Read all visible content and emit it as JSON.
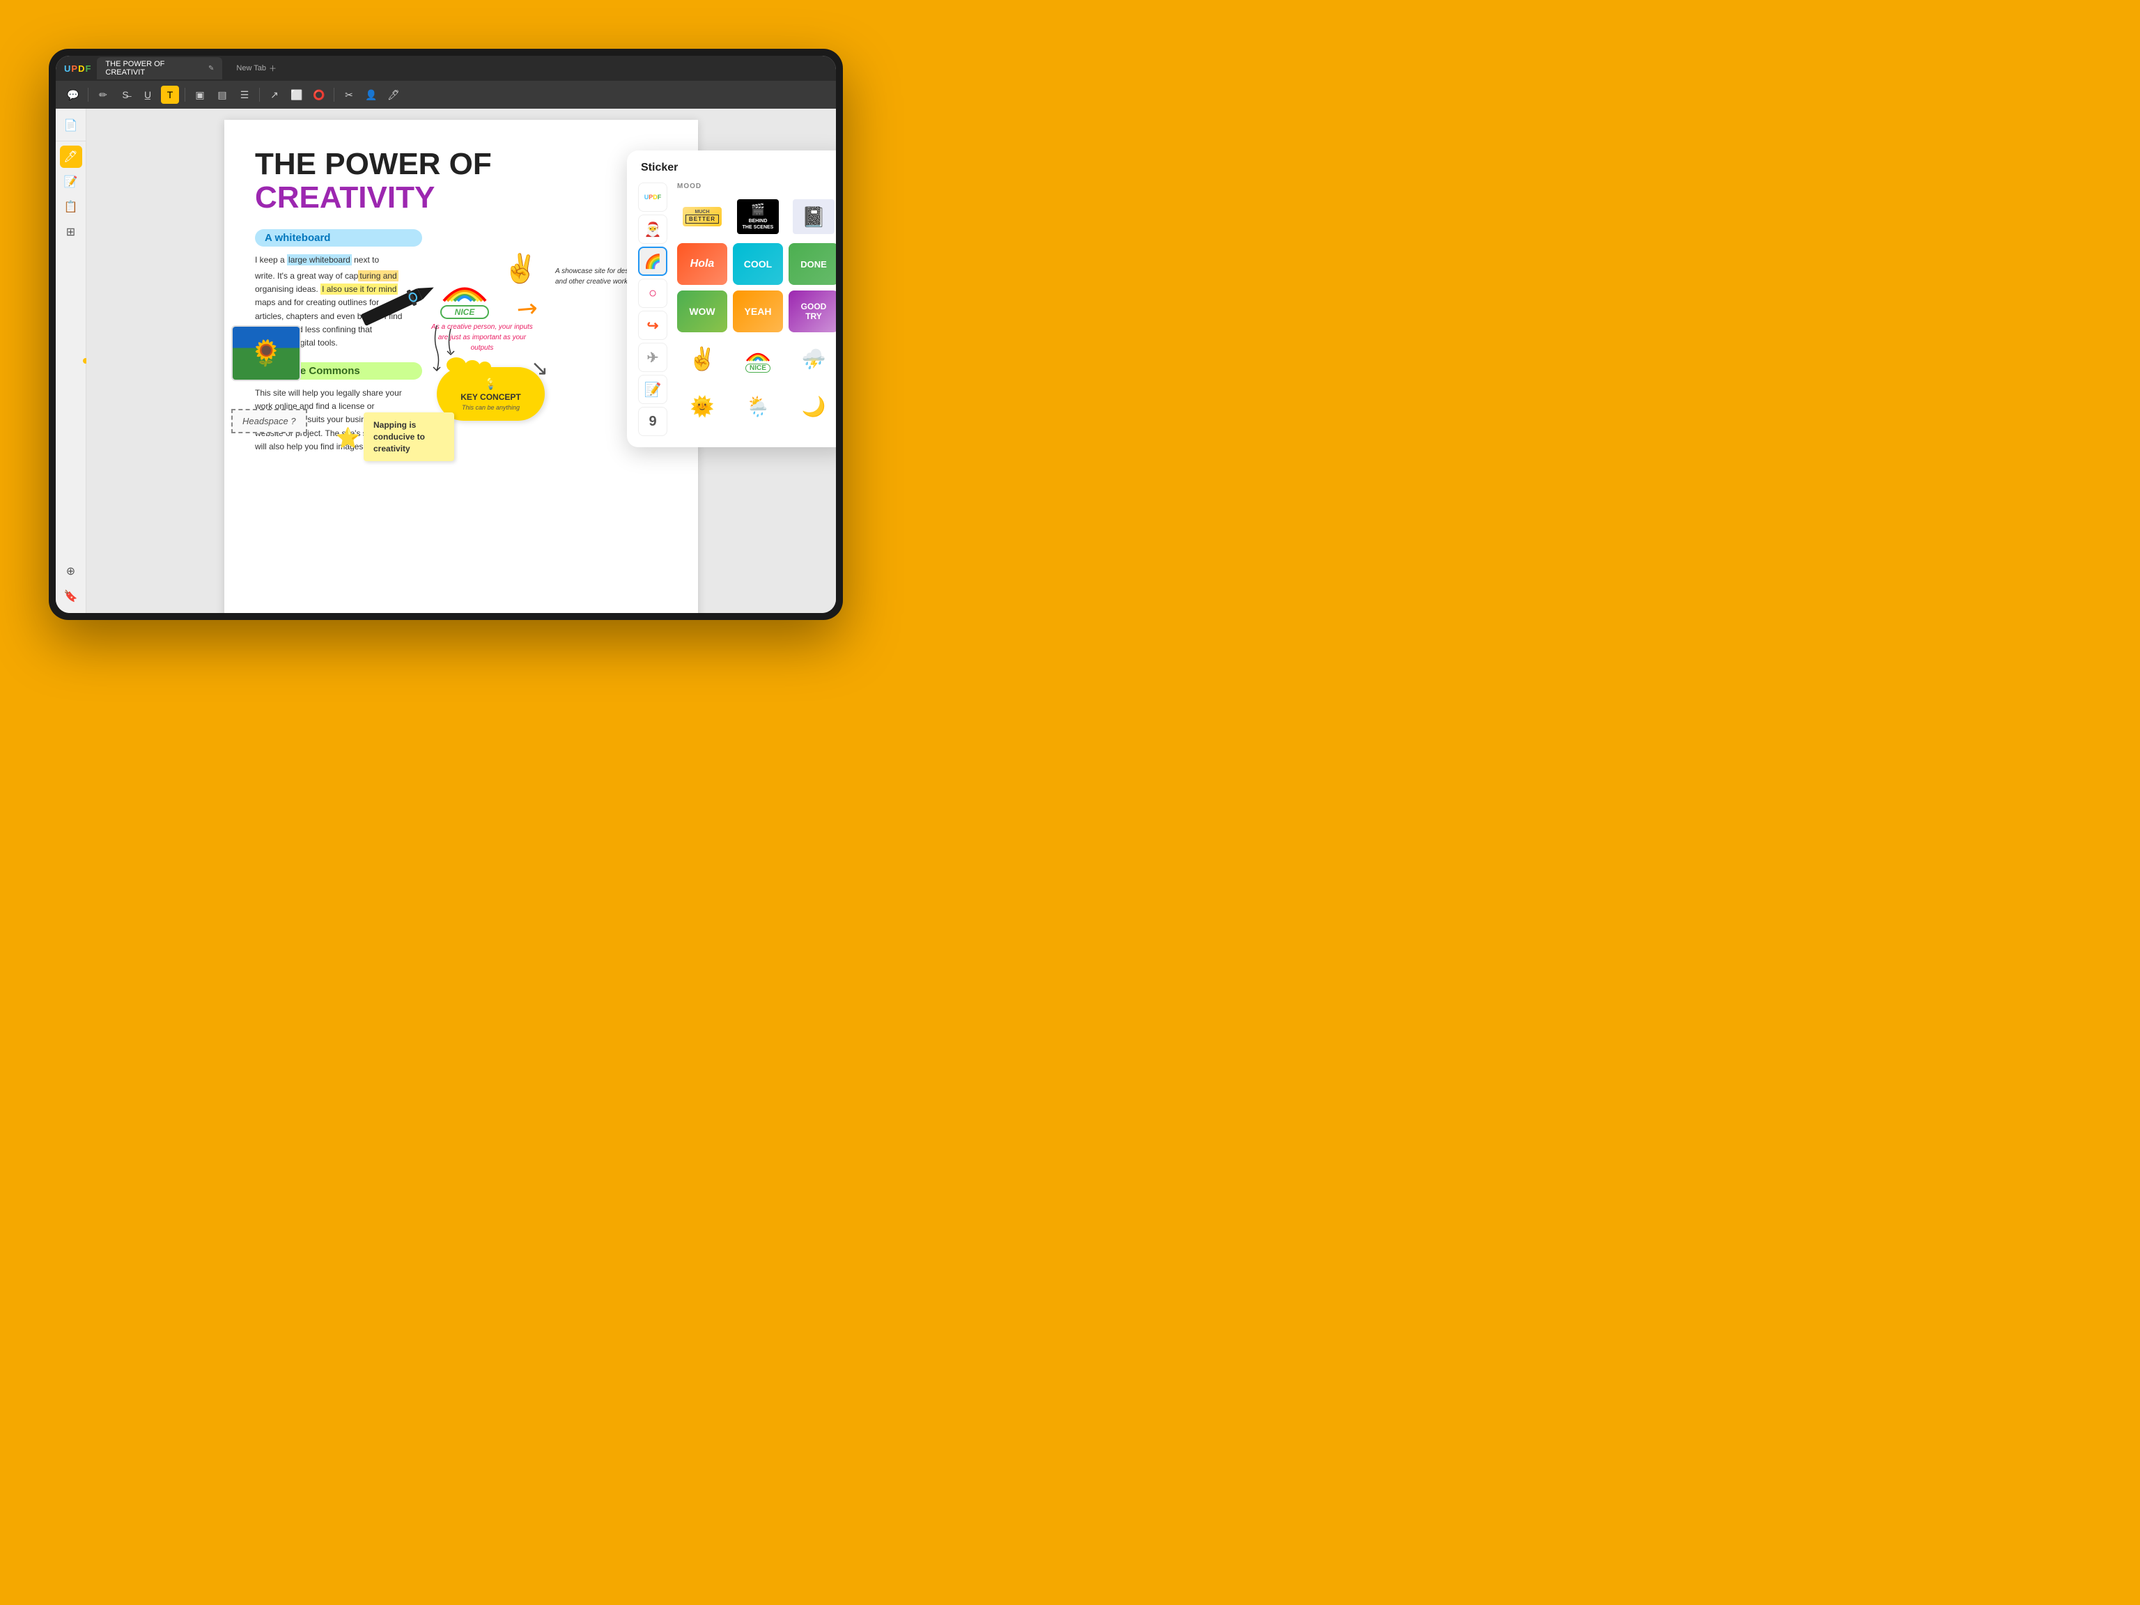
{
  "app": {
    "name": "UPDF",
    "logo_letters": {
      "u": "U",
      "p": "P",
      "d": "D",
      "f": "F"
    }
  },
  "tabs": [
    {
      "label": "THE POWER OF CREATIVIT",
      "active": true
    },
    {
      "label": "New Tab",
      "active": false
    }
  ],
  "toolbar": {
    "icons": [
      "comment",
      "pencil",
      "strikethrough",
      "underline",
      "text-T",
      "text-box",
      "text-cols",
      "list",
      "separator",
      "arrow-tool",
      "shape",
      "lasso",
      "crop",
      "user",
      "highlight"
    ]
  },
  "sidebar": {
    "top_icons": [
      "book",
      "minus",
      "highlighter",
      "edit-note",
      "copy",
      "layers",
      "bookmark"
    ],
    "bottom_icons": [
      "layers2",
      "bookmark2"
    ]
  },
  "document": {
    "title_line1": "THE POWER OF",
    "title_line2": "CREATIVITY",
    "section1_tag": "A whiteboard",
    "section1_text": "I keep a large whiteboard next to my desk where I write. It's a great way of capturing and organising ideas. I also use it for mind maps and for creating outlines for articles, chapters and even books. I find a whiteboard less confining that traditional digital tools.",
    "section2_tag": "Creative Commons",
    "section2_text": "This site will help you legally share your work online and find a license or copyright that suits your business model, website or project. The site's search tool will also help you find images, music and",
    "visual_text1": "A showcase site for design and other creative work.",
    "italic_text": "As a creative person, your inputs are just as important as your outputs",
    "key_concept_title": "KEY CONCEPT",
    "key_concept_sub": "This can be anything",
    "headspace_label": "Headspace ?",
    "napping_text": "Napping is conducive to creativity"
  },
  "sticker_panel": {
    "title": "Sticker",
    "category_label": "MOOD",
    "categories": [
      {
        "name": "updf",
        "label": "UPDF"
      },
      {
        "name": "hat",
        "label": "🎅"
      },
      {
        "name": "rainbow",
        "label": "🌈"
      },
      {
        "name": "circle",
        "label": "○"
      },
      {
        "name": "arrow",
        "label": "↪"
      },
      {
        "name": "plane",
        "label": "✈"
      },
      {
        "name": "note",
        "label": "📝"
      },
      {
        "name": "nine",
        "label": "9"
      }
    ],
    "stickers": [
      {
        "id": "much-better",
        "label": "MUCH BETTER"
      },
      {
        "id": "behind-scenes",
        "label": "BEHIND THE SCENES"
      },
      {
        "id": "notepad",
        "label": "📓"
      },
      {
        "id": "hola",
        "label": "Hola"
      },
      {
        "id": "cool",
        "label": "COOL"
      },
      {
        "id": "done",
        "label": "DONE"
      },
      {
        "id": "wow",
        "label": "WOW"
      },
      {
        "id": "yeah",
        "label": "YEAH"
      },
      {
        "id": "good-try",
        "label": "GOOD TRY"
      },
      {
        "id": "peace",
        "label": "✌"
      },
      {
        "id": "nice-rainbow",
        "label": "NICE"
      },
      {
        "id": "thunder",
        "label": "⚡"
      },
      {
        "id": "sun-face",
        "label": "😎"
      },
      {
        "id": "rain-cloud",
        "label": "🌧"
      },
      {
        "id": "moon",
        "label": "🌙"
      }
    ]
  }
}
